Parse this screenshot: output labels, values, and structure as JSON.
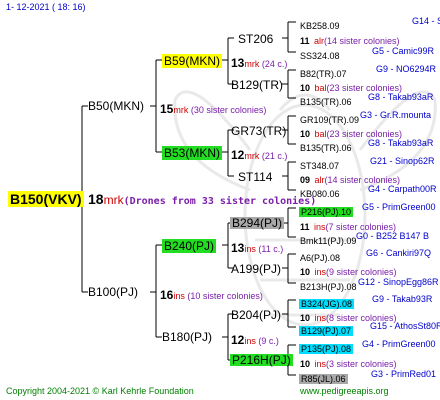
{
  "date": "1- 12-2021 ( 18: 16)",
  "root": {
    "name": "B150(VKV)",
    "number": "18",
    "unit": "mrk",
    "note": "(Drones from 33 sister colonies)"
  },
  "gen1": [
    {
      "name": "B50(MKN)",
      "number": "15",
      "unit": "mrk",
      "note": " (30 sister colonies)"
    },
    {
      "name": "B100(PJ)",
      "number": "16",
      "unit": "ins",
      "note": "  (10 sister colonies)"
    }
  ],
  "gen2": [
    {
      "name": "B59(MKN)",
      "number": "13",
      "unit": "mrk",
      "note": " (24 c.)"
    },
    {
      "name": "B53(MKN)",
      "number": "12",
      "unit": "mrk",
      "note": " (21 c.)"
    },
    {
      "name": "B240(PJ)",
      "number": "13",
      "unit": "ins",
      "note": "  (11 c.)"
    },
    {
      "name": "B180(PJ)",
      "number": "12",
      "unit": "ins",
      "note": "  (9 c.)"
    }
  ],
  "gen3": [
    {
      "name": "ST206"
    },
    {
      "name": "B129(TR)"
    },
    {
      "name": "GR73(TR)"
    },
    {
      "name": "ST114"
    },
    {
      "name": "B294(PJ)"
    },
    {
      "name": "A199(PJ)"
    },
    {
      "name": "B204(PJ)"
    },
    {
      "name": "P216H(PJ)"
    }
  ],
  "gen4": [
    {
      "name": "KB258.09",
      "src": "G14 - SinopEgg86R"
    },
    {
      "number": "11",
      "unit": "alr",
      "note": "(14 sister colonies)"
    },
    {
      "name": "SS324.08",
      "src": "G5 - Camic99R"
    },
    {
      "name": "B82(TR).07",
      "src": "G9 - NO6294R"
    },
    {
      "number": "10",
      "unit": "bal",
      "note": "(23 sister colonies)"
    },
    {
      "name": "B135(TR).06",
      "src": "G8 - Takab93aR"
    },
    {
      "name": "GR109(TR).09",
      "src": "G3 - Gr.R.mounta"
    },
    {
      "number": "10",
      "unit": "bal",
      "note": "(23 sister colonies)"
    },
    {
      "name": "B135(TR).06",
      "src": "G8 - Takab93aR"
    },
    {
      "name": "ST348.07",
      "src": "G21 - Sinop62R"
    },
    {
      "number": "09",
      "unit": "alr",
      "note": "(14 sister colonies)"
    },
    {
      "name": "KB080.06",
      "src": "G4 - Carpath00R"
    },
    {
      "name": "P216(PJ).10",
      "src": "G5 - PrimGreen00"
    },
    {
      "number": "11",
      "unit": "ins",
      "note": "(7 sister colonies)"
    },
    {
      "name": "Bmk11(PJ).09",
      "src": "G0 - B252 B147 B"
    },
    {
      "name": "A6(PJ).08",
      "src": "G6 - Cankiri97Q"
    },
    {
      "number": "10",
      "unit": "ins",
      "note": "(9 sister colonies)"
    },
    {
      "name": "B213H(PJ).08",
      "src": "G12 - SinopEgg86R"
    },
    {
      "name": "B324(JG).08",
      "src": "G9 - Takab93R"
    },
    {
      "number": "10",
      "unit": "ins",
      "note": "(8 sister colonies)"
    },
    {
      "name": "B129(PJ).07",
      "src": "G15 - AthosSt80R"
    },
    {
      "name": "P135(PJ).08",
      "src": "G4 - PrimGreen00"
    },
    {
      "number": "10",
      "unit": "ins",
      "note": "(3 sister colonies)"
    },
    {
      "name": "R85(JL).06",
      "src": "G3 - PrimRed01"
    }
  ],
  "footer": {
    "copyright": "Copyright 2004-2021 © Karl Kehrle Foundation",
    "website": "www.pedigreeapis.org"
  }
}
